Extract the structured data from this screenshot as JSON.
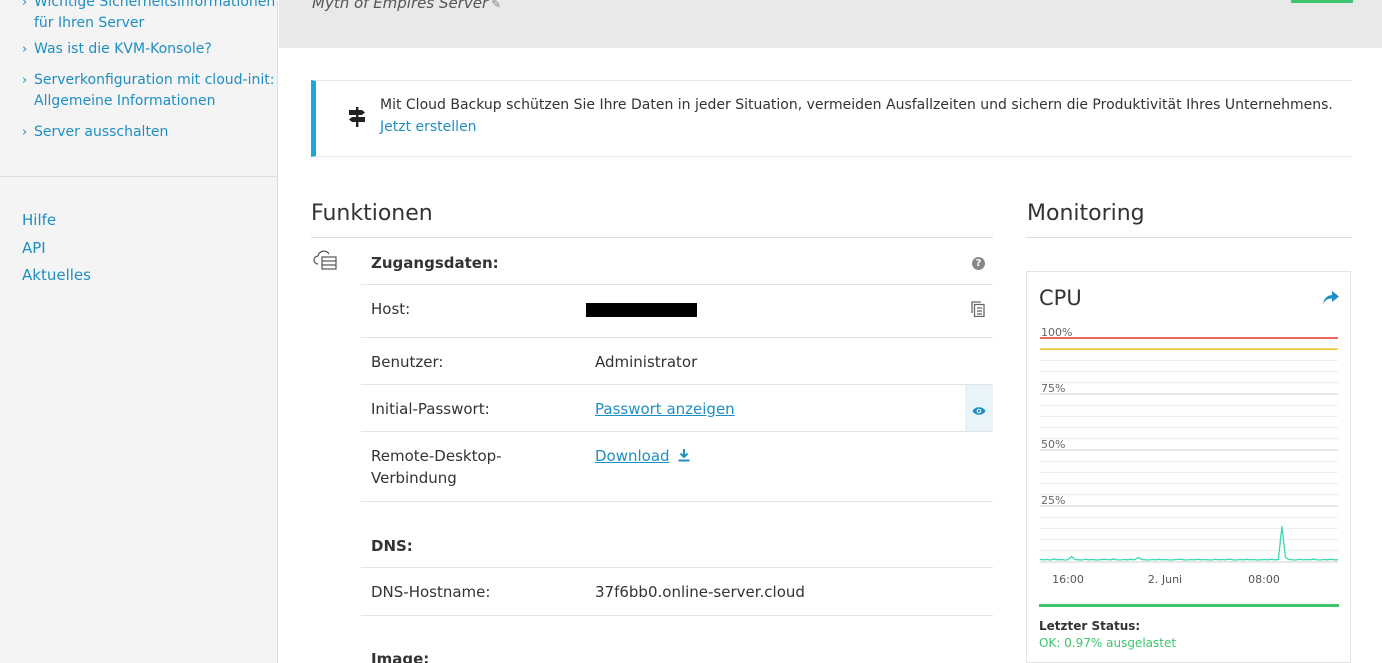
{
  "sidebar": {
    "links": [
      {
        "lines": [
          "Wichtige Sicherheitsinformationen",
          "für Ihren Server"
        ]
      },
      {
        "lines": [
          "Was ist die KVM-Konsole?"
        ]
      },
      {
        "lines": [
          "Serverkonfiguration mit cloud-init:",
          "Allgemeine Informationen"
        ]
      },
      {
        "lines": [
          "Server ausschalten"
        ]
      }
    ],
    "chevron": "›",
    "bottom_links": [
      "Hilfe",
      "API",
      "Aktuelles"
    ]
  },
  "header": {
    "server_name": "Myth of Empires Server",
    "edit_icon": "pencil-icon"
  },
  "banner": {
    "icon": "signpost-icon",
    "text": "Mit Cloud Backup schützen Sie Ihre Daten in jeder Situation, vermeiden Ausfallzeiten und sichern die Produktivität Ihres Unternehmens.",
    "cta": "Jetzt erstellen"
  },
  "functions": {
    "title": "Funktionen",
    "icon": "cloud-server-icon",
    "access": {
      "heading": "Zugangsdaten:",
      "help_icon": "?",
      "host_label": "Host:",
      "user_label": "Benutzer:",
      "user_value": "Administrator",
      "password_label": "Initial-Passwort:",
      "password_link": "Passwort anzeigen",
      "rdp_label_line1": "Remote-Desktop-",
      "rdp_label_line2": "Verbindung",
      "rdp_link": "Download"
    },
    "dns": {
      "heading": "DNS:",
      "hostname_label": "DNS-Hostname:",
      "hostname_value": "37f6bb0.online-server.cloud"
    },
    "image": {
      "heading": "Image:"
    }
  },
  "monitoring": {
    "title": "Monitoring",
    "card_title": "CPU",
    "last_status_label": "Letzter Status:",
    "last_status_value": "OK: 0.97% ausgelastet",
    "colors": {
      "red_line": "#e8342e",
      "yellow_line": "#e8c21a",
      "series": "#3fd8b2",
      "status_bar": "#3ec46d"
    },
    "chart_data": {
      "type": "line",
      "ylim": [
        0,
        100
      ],
      "y_ticks": [
        "100%",
        "75%",
        "50%",
        "25%"
      ],
      "x_ticks": [
        "16:00",
        "2. Juni",
        "08:00"
      ],
      "thresholds": [
        {
          "value": 100,
          "color": "#e8342e"
        },
        {
          "value": 95,
          "color": "#e8c21a"
        }
      ],
      "series": [
        {
          "values": [
            1.2,
            1.0,
            1.1,
            0.9,
            1.3,
            1.0,
            1.1,
            0.9,
            1.0,
            2.5,
            1.1,
            1.0,
            0.9,
            1.2,
            1.0,
            1.1,
            0.9,
            1.0,
            1.2,
            1.1,
            1.0,
            1.3,
            1.0,
            0.9,
            1.1,
            1.0,
            1.2,
            1.0,
            2.0,
            1.1,
            1.0,
            0.9,
            1.1,
            1.0,
            1.2,
            1.0,
            1.1,
            0.9,
            1.0,
            1.1,
            1.3,
            1.0,
            0.9,
            1.1,
            1.0,
            1.2,
            1.0,
            1.1,
            1.0,
            0.9,
            1.2,
            1.0,
            1.1,
            1.0,
            1.3,
            1.0,
            0.9,
            1.1,
            1.0,
            1.2,
            1.0,
            1.1,
            0.9,
            1.0,
            1.1,
            1.0,
            1.2,
            1.0,
            1.1,
            16.0,
            2.0,
            1.1,
            1.0,
            0.9,
            1.2,
            1.0,
            1.1,
            1.0,
            1.3,
            1.0,
            0.9,
            1.1,
            1.0,
            1.2,
            1.0,
            1.0
          ]
        }
      ]
    }
  }
}
